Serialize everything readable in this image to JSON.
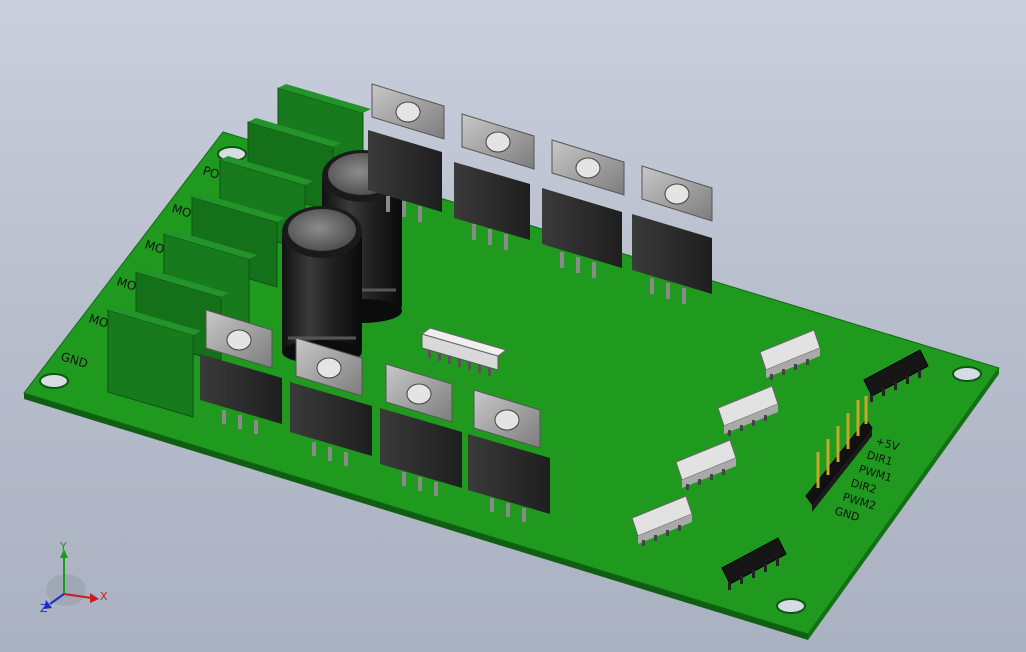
{
  "board": {
    "left_labels": [
      "PO",
      "MO",
      "MO",
      "MO",
      "MO",
      "GND"
    ],
    "header_labels": [
      "+5V",
      "DIR1",
      "PWM1",
      "DIR2",
      "PWM2",
      "GND"
    ]
  },
  "triad": {
    "y": "Y",
    "x": "X",
    "z": "Z"
  },
  "colors": {
    "pcb": "#1f9a1f",
    "terminal": "#15701a",
    "component": "#2a2a2a",
    "tab": "#9b9b9b",
    "background": "#c0c6d3"
  }
}
